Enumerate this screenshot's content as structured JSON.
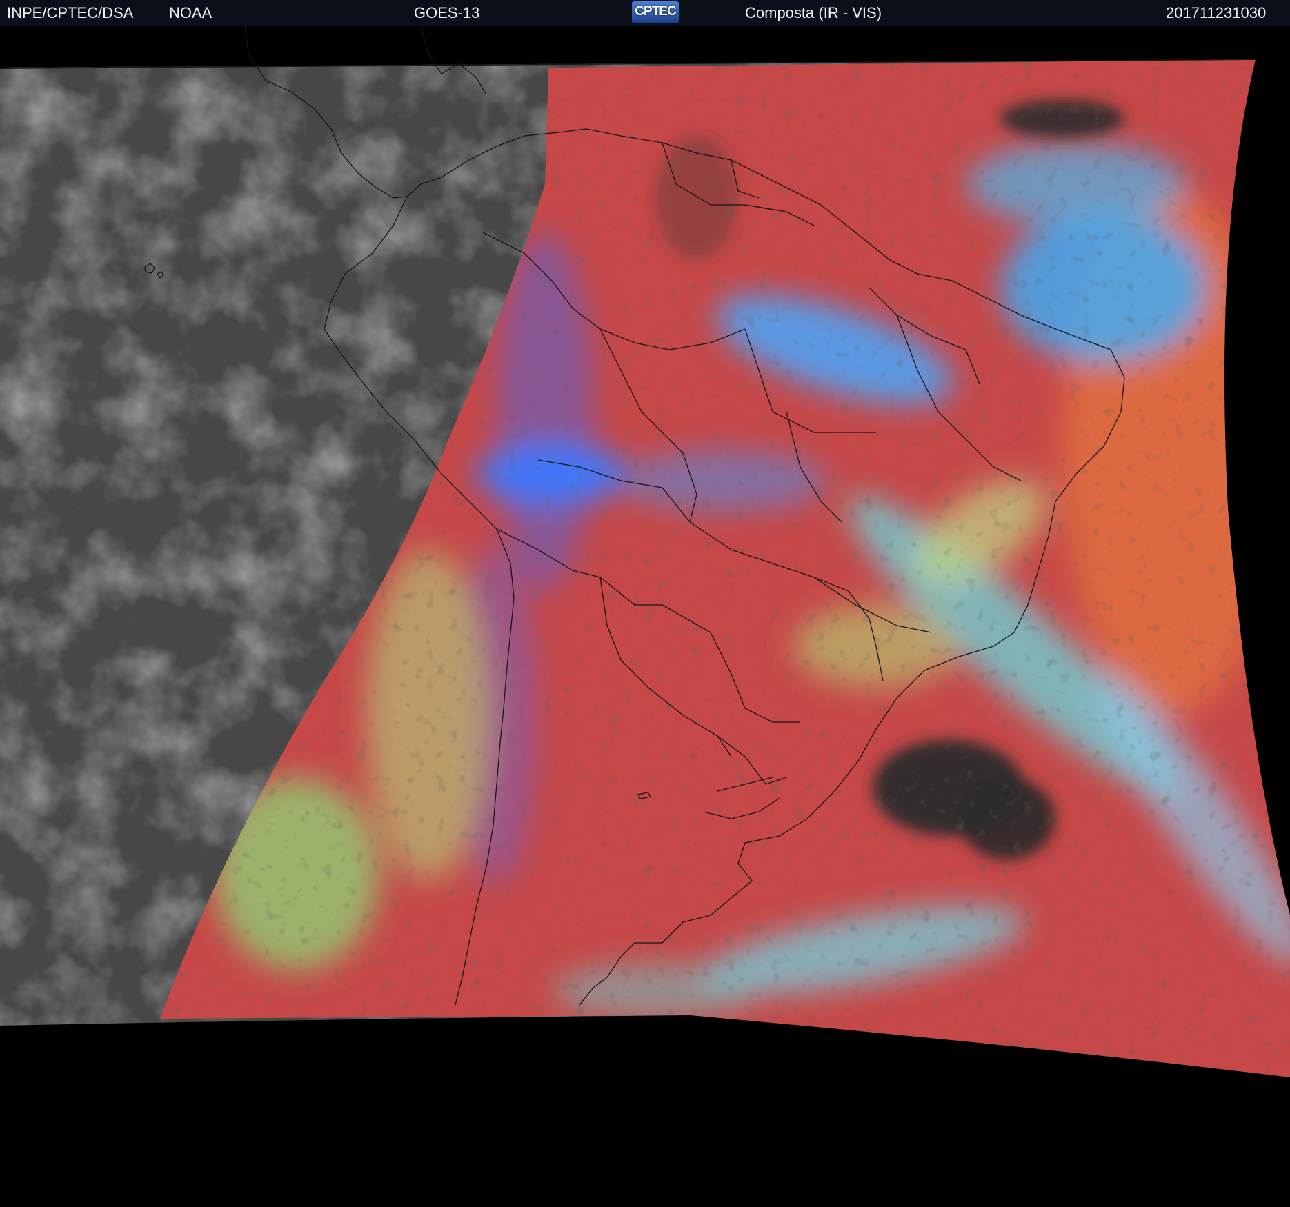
{
  "header": {
    "org": "INPE/CPTEC/DSA",
    "agency": "NOAA",
    "satellite": "GOES-13",
    "logo": "CPTEC",
    "product": "Composta (IR - VIS)",
    "timestamp": "201711231030"
  },
  "colors": {
    "header_bg": "#0a0f1a",
    "ir_gray": "#4a4a4a",
    "vis_red": "#c84a4a",
    "cloud_cyan": "#46c8e6",
    "cloud_blue": "#2a6aff",
    "no_data_gray": "#a8a8a8",
    "space_black": "#000000"
  }
}
